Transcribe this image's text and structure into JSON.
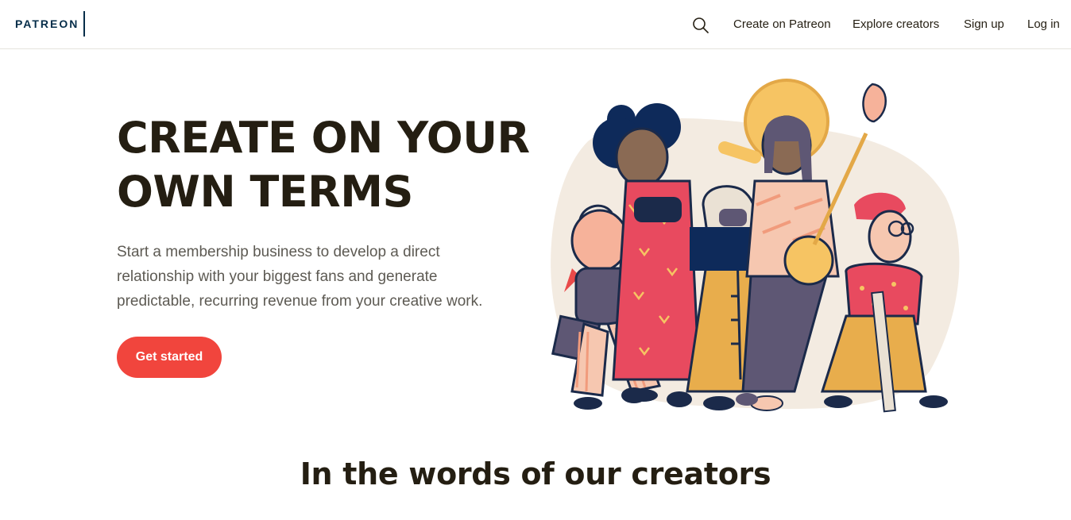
{
  "brand": {
    "logo_text": "PATREON",
    "color": "#052d49"
  },
  "nav": {
    "search_icon": "search-icon",
    "links": [
      "Create on Patreon",
      "Explore creators",
      "Sign up",
      "Log in"
    ]
  },
  "hero": {
    "title_line1": "CREATE ON YOUR",
    "title_line2": "OWN TERMS",
    "subtitle_line1": "Start a membership business to develop a direct",
    "subtitle_line2": "relationship with your biggest fans and generate",
    "subtitle_line3": "predictable, recurring revenue from your creative work.",
    "cta_label": "Get started",
    "cta_color": "#f1453d"
  },
  "section": {
    "title": "In the words of our creators"
  }
}
